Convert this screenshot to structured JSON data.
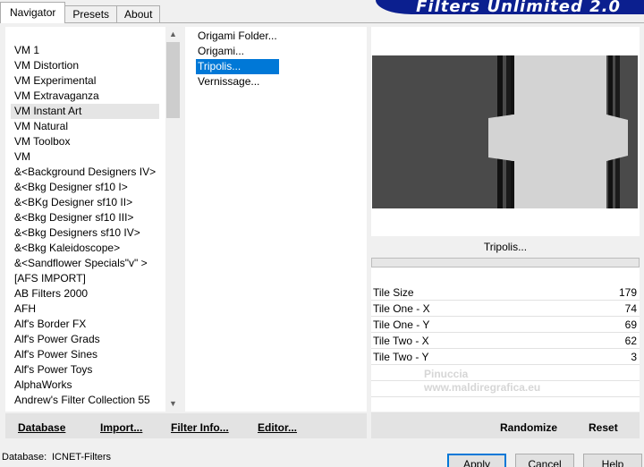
{
  "tabs": [
    {
      "label": "Navigator",
      "active": true
    },
    {
      "label": "Presets",
      "active": false
    },
    {
      "label": "About",
      "active": false
    }
  ],
  "banner": {
    "title": "Filters Unlimited 2.0",
    "color": "#0b1f8f"
  },
  "categories": {
    "selected": "VM Instant Art",
    "items": [
      "VM 1",
      "VM Distortion",
      "VM Experimental",
      "VM Extravaganza",
      "VM Instant Art",
      "VM Natural",
      "VM Toolbox",
      "VM",
      "&<Background Designers IV>",
      "&<Bkg Designer sf10 I>",
      "&<BKg Designer sf10 II>",
      "&<Bkg Designer sf10 III>",
      "&<Bkg Designers sf10 IV>",
      "&<Bkg Kaleidoscope>",
      "&<Sandflower Specials\"v\" >",
      "[AFS IMPORT]",
      "AB Filters 2000",
      "AFH",
      "Alf's Border FX",
      "Alf's Power Grads",
      "Alf's Power Sines",
      "Alf's Power Toys",
      "AlphaWorks",
      "Andrew's Filter Collection 55"
    ]
  },
  "filters": {
    "selected": "Tripolis...",
    "items": [
      "Origami Folder...",
      "Origami...",
      "Tripolis...",
      "Vernissage..."
    ]
  },
  "preview": {
    "filter_title": "Tripolis..."
  },
  "params": [
    {
      "name": "Tile Size",
      "value": "179"
    },
    {
      "name": "Tile One - X",
      "value": "74"
    },
    {
      "name": "Tile One - Y",
      "value": "69"
    },
    {
      "name": "Tile Two - X",
      "value": "62"
    },
    {
      "name": "Tile Two - Y",
      "value": "3"
    }
  ],
  "watermark": {
    "line1": "Pinuccia",
    "line2": "www.maldiregrafica.eu"
  },
  "toolbar_left": {
    "database": "Database",
    "import": "Import...",
    "filter_info": "Filter Info...",
    "editor": "Editor..."
  },
  "toolbar_right": {
    "randomize": "Randomize",
    "reset": "Reset"
  },
  "status": {
    "database_label": "Database:",
    "database_value": "ICNET-Filters"
  },
  "dialog": {
    "apply": "Apply",
    "cancel": "Cancel",
    "help": "Help"
  }
}
